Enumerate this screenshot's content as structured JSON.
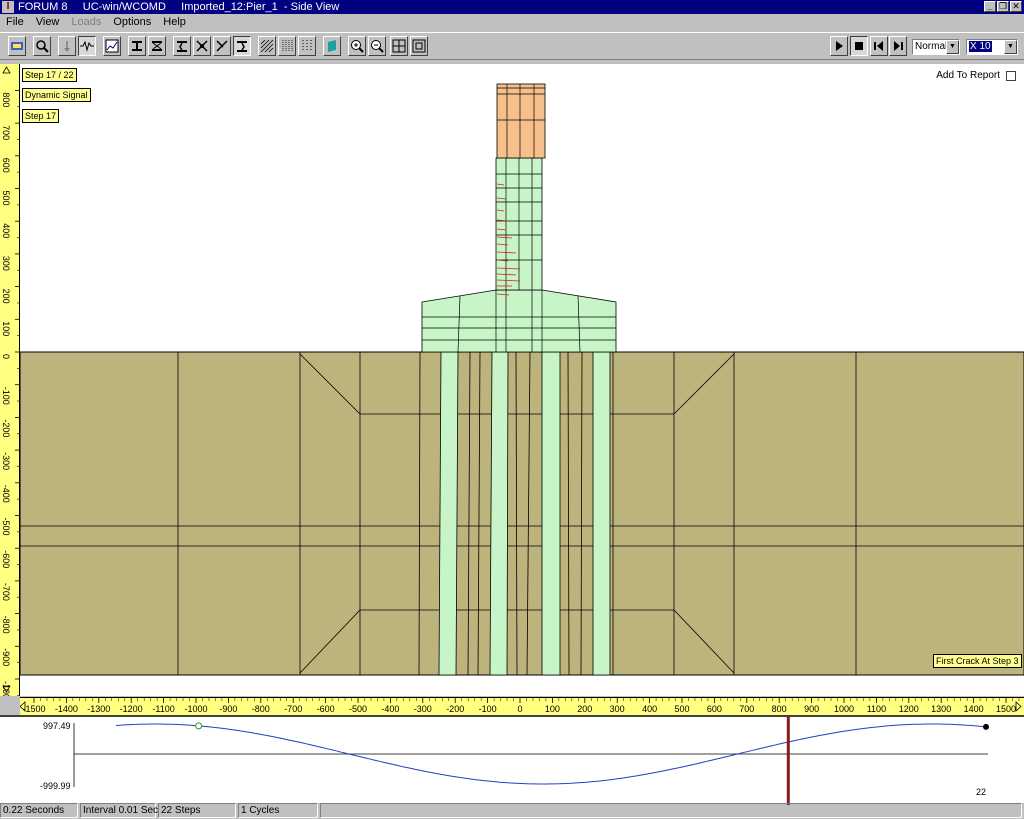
{
  "window": {
    "title": "FORUM 8     UC-win/WCOMD     Imported_12:Pier_1  - Side View",
    "app_icon": "I"
  },
  "menu": {
    "file": "File",
    "view": "View",
    "loads": "Loads",
    "options": "Options",
    "help": "Help"
  },
  "toolbar": {
    "icons": [
      "edit-mesh-icon",
      "zoom-mesh-icon",
      "load-arrow-icon",
      "signal-wave-icon",
      "graph-icon",
      "beam-a-icon",
      "beam-b-icon",
      "deform-a-icon",
      "deform-b-icon",
      "deform-c-icon",
      "deform-d-icon",
      "hatch-a-icon",
      "hatch-b-icon",
      "hatch-c-icon",
      "color-fill-icon",
      "zoom-in-icon",
      "zoom-out-icon",
      "fit-all-icon",
      "fit-window-icon"
    ],
    "play_icons": [
      "play-icon",
      "stop-icon",
      "step-back-icon",
      "step-forward-icon"
    ],
    "speed_select": "Normal",
    "scale_select": "X 10"
  },
  "canvas": {
    "step_tag": "Step 17 / 22",
    "signal_tag": "Dynamic Signal",
    "step_tag_2": "Step 17",
    "add_to_report": "Add To Report",
    "first_crack": "First Crack At Step 3",
    "colors": {
      "soil": "#bdb37d",
      "pile": "#c8f5c8",
      "cap": "#f7c08a",
      "crack": "#d02020"
    }
  },
  "vruler": {
    "labels": [
      "800",
      "700",
      "600",
      "500",
      "400",
      "300",
      "200",
      "100",
      "0",
      "-100",
      "-200",
      "-300",
      "-400",
      "-500",
      "-600",
      "-700",
      "-800",
      "-900",
      "-1000"
    ]
  },
  "hruler": {
    "labels": [
      "-1500",
      "-1400",
      "-1300",
      "-1200",
      "-1100",
      "-1000",
      "-900",
      "-800",
      "-700",
      "-600",
      "-500",
      "-400",
      "-300",
      "-200",
      "-100",
      "0",
      "100",
      "200",
      "300",
      "400",
      "500",
      "600",
      "700",
      "800",
      "900",
      "1000",
      "1100",
      "1200",
      "1300",
      "1400",
      "1500"
    ]
  },
  "signal": {
    "max_label": "997.49",
    "min_label": "-999.99",
    "end_step_label": "22",
    "current_step": 17,
    "total_steps": 22
  },
  "status": {
    "time": "0.22 Seconds",
    "interval": "Interval 0.01 Sec",
    "steps": "22 Steps",
    "cycles": "1 Cycles"
  }
}
